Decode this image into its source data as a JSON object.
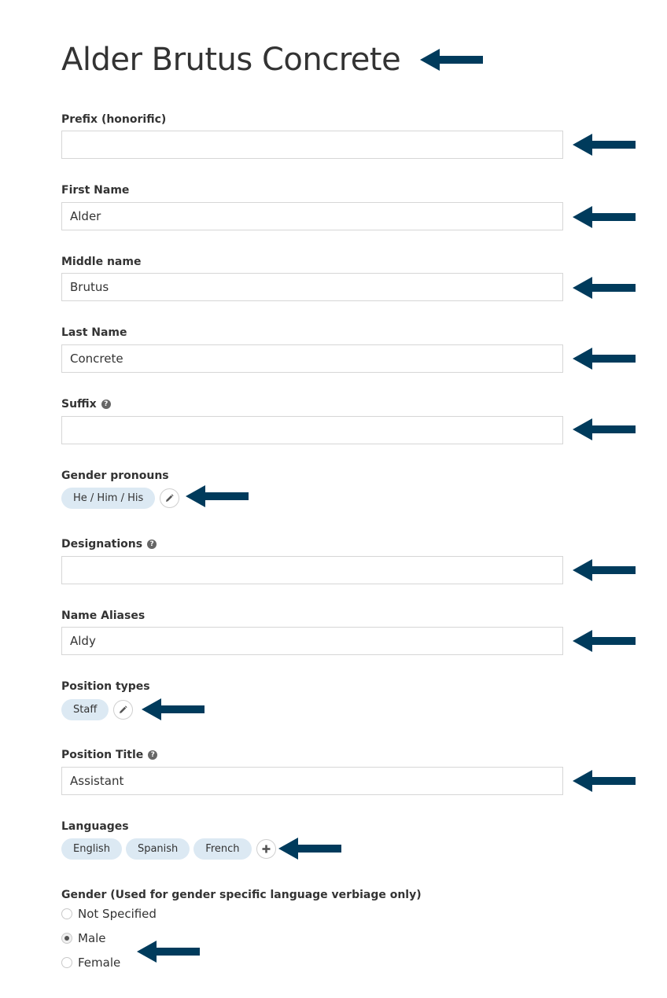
{
  "colors": {
    "arrow": "#003b5c",
    "chip_bg": "#dce9f3",
    "field_border": "#d6d6d6"
  },
  "page_title": "Alder Brutus Concrete",
  "fields": {
    "prefix": {
      "label": "Prefix (honorific)",
      "value": ""
    },
    "first_name": {
      "label": "First Name",
      "value": "Alder"
    },
    "middle_name": {
      "label": "Middle name",
      "value": "Brutus"
    },
    "last_name": {
      "label": "Last Name",
      "value": "Concrete"
    },
    "suffix": {
      "label": "Suffix",
      "value": ""
    },
    "designations": {
      "label": "Designations",
      "value": ""
    },
    "name_aliases": {
      "label": "Name Aliases",
      "value": "Aldy"
    },
    "position_title": {
      "label": "Position Title",
      "value": "Assistant"
    }
  },
  "gender_pronouns": {
    "label": "Gender pronouns",
    "chips": [
      "He / Him / His"
    ],
    "action_icon": "pencil-icon"
  },
  "position_types": {
    "label": "Position types",
    "chips": [
      "Staff"
    ],
    "action_icon": "pencil-icon"
  },
  "languages": {
    "label": "Languages",
    "chips": [
      "English",
      "Spanish",
      "French"
    ],
    "action_icon": "plus-icon"
  },
  "gender": {
    "label": "Gender (Used for gender specific language verbiage only)",
    "options": [
      "Not Specified",
      "Male",
      "Female"
    ],
    "selected": "Male"
  },
  "help_icon": "?"
}
